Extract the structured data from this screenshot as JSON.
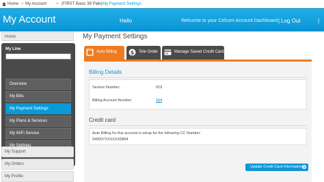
{
  "breadcrumb": {
    "home_label": "Home",
    "items": [
      "My Account",
      "(FIRST Basic 38 Plan)",
      "My Payment Settings"
    ],
    "separator": ">"
  },
  "header": {
    "title": "My Account",
    "hello": "Hello",
    "welcome": "Welcome to your Celcom Account Dashboard",
    "separator": "|",
    "logout": "Log Out"
  },
  "sidebar": {
    "home": "Home",
    "my_line_label": "My Line",
    "line_select_value": "",
    "items": [
      {
        "label": "Overview",
        "active": false
      },
      {
        "label": "My Bills",
        "active": false
      },
      {
        "label": "My Payment Settings",
        "active": true
      },
      {
        "label": "My Plans & Services",
        "active": false
      },
      {
        "label": "My WiFi Service",
        "active": false
      },
      {
        "label": "My Settings",
        "active": false
      }
    ],
    "extra": [
      "My Support",
      "My Orders",
      "My Profile"
    ]
  },
  "main": {
    "title": "My Payment Settings",
    "tabs": [
      {
        "label": "Auto Billing",
        "icon": "calendar-icon",
        "active": true
      },
      {
        "label": "Tele Order",
        "icon": "dollar-icon",
        "active": false
      },
      {
        "label": "Manage Saved Credit Card",
        "icon": "credit-card-icon",
        "active": false
      }
    ],
    "billing": {
      "heading": "Billing Details",
      "service_number_label": "Service Number:",
      "service_number_value": "019",
      "account_number_label": "Billing Account Number:",
      "account_number_value": "164"
    },
    "credit_card": {
      "heading": "Credit card",
      "description": "Auto Billing for this account is setup for the following CC Number:",
      "cc_number": "540007XXXXXX5894"
    },
    "update_button": "Update Credit Card Information"
  },
  "colors": {
    "brand_blue": "#0a9ad6",
    "tab_orange": "#f07b1e",
    "sidebar_dark": "#4a4a4a"
  }
}
